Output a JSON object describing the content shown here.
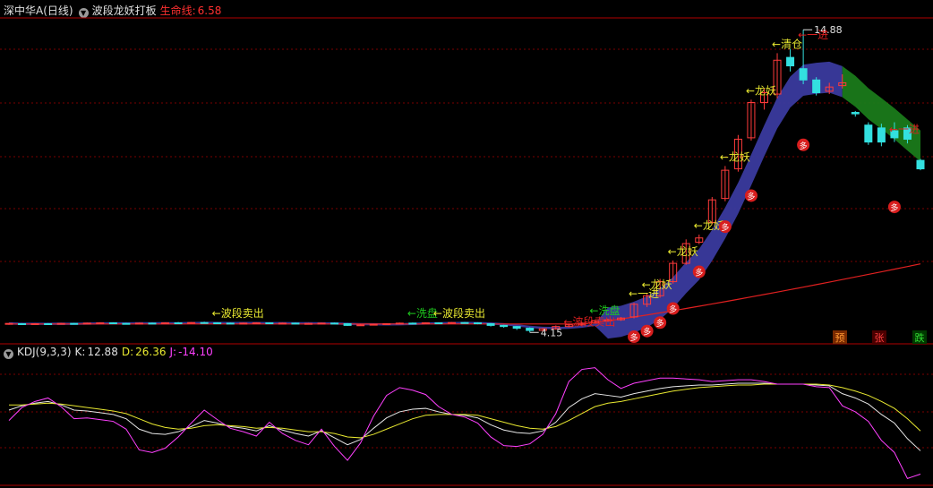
{
  "header": {
    "stock_title": "深中华A(日线)",
    "indicator_name": "波段龙妖打板",
    "lifeline_label": "生命线:",
    "lifeline_value": "6.58"
  },
  "kdj": {
    "title": "KDJ(9,3,3)",
    "k_label": "K:",
    "k_value": "12.88",
    "d_label": "D:",
    "d_value": "26.36",
    "j_label": "J:",
    "j_value": "-14.10"
  },
  "chart_data": [
    {
      "type": "candlestick",
      "title": "深中华A(日线)",
      "price_high_label": "14.88",
      "price_low_label": "4.15",
      "x": [
        1,
        2,
        3,
        4,
        5,
        6,
        7,
        8,
        9,
        10,
        11,
        12,
        13,
        14,
        15,
        16,
        17,
        18,
        19,
        20,
        21,
        22,
        23,
        24,
        25,
        26,
        27,
        28,
        29,
        30,
        31,
        32,
        33,
        34,
        35,
        36,
        37,
        38,
        39,
        40,
        41,
        42,
        43,
        44,
        45,
        46,
        47,
        48,
        49,
        50,
        51,
        52,
        53,
        54,
        55,
        56,
        57,
        58,
        59,
        60,
        61,
        62,
        63,
        64,
        65,
        66,
        67,
        68,
        69,
        70,
        71
      ],
      "candles": [
        [
          4.45,
          4.47,
          4.49,
          4.42
        ],
        [
          4.46,
          4.44,
          4.48,
          4.42
        ],
        [
          4.44,
          4.46,
          4.48,
          4.42
        ],
        [
          4.46,
          4.45,
          4.48,
          4.43
        ],
        [
          4.45,
          4.47,
          4.49,
          4.43
        ],
        [
          4.47,
          4.46,
          4.49,
          4.44
        ],
        [
          4.46,
          4.48,
          4.5,
          4.44
        ],
        [
          4.48,
          4.49,
          4.51,
          4.46
        ],
        [
          4.49,
          4.47,
          4.51,
          4.45
        ],
        [
          4.47,
          4.46,
          4.49,
          4.44
        ],
        [
          4.46,
          4.48,
          4.5,
          4.44
        ],
        [
          4.48,
          4.47,
          4.5,
          4.45
        ],
        [
          4.47,
          4.49,
          4.51,
          4.45
        ],
        [
          4.49,
          4.48,
          4.52,
          4.46
        ],
        [
          4.48,
          4.5,
          4.52,
          4.46
        ],
        [
          4.5,
          4.49,
          4.53,
          4.47
        ],
        [
          4.49,
          4.48,
          4.51,
          4.46
        ],
        [
          4.48,
          4.47,
          4.5,
          4.45
        ],
        [
          4.47,
          4.48,
          4.5,
          4.45
        ],
        [
          4.48,
          4.49,
          4.51,
          4.46
        ],
        [
          4.49,
          4.47,
          4.51,
          4.45
        ],
        [
          4.47,
          4.48,
          4.5,
          4.45
        ],
        [
          4.48,
          4.46,
          4.5,
          4.44
        ],
        [
          4.46,
          4.47,
          4.49,
          4.44
        ],
        [
          4.47,
          4.48,
          4.5,
          4.45
        ],
        [
          4.48,
          4.46,
          4.5,
          4.44
        ],
        [
          4.46,
          4.4,
          4.48,
          4.38
        ],
        [
          4.4,
          4.42,
          4.45,
          4.38
        ],
        [
          4.42,
          4.44,
          4.46,
          4.4
        ],
        [
          4.44,
          4.46,
          4.48,
          4.42
        ],
        [
          4.46,
          4.48,
          4.5,
          4.44
        ],
        [
          4.48,
          4.47,
          4.5,
          4.45
        ],
        [
          4.47,
          4.49,
          4.51,
          4.45
        ],
        [
          4.49,
          4.48,
          4.51,
          4.46
        ],
        [
          4.48,
          4.5,
          4.52,
          4.46
        ],
        [
          4.5,
          4.49,
          4.52,
          4.47
        ],
        [
          4.49,
          4.46,
          4.51,
          4.44
        ],
        [
          4.46,
          4.4,
          4.48,
          4.36
        ],
        [
          4.4,
          4.36,
          4.42,
          4.32
        ],
        [
          4.36,
          4.3,
          4.38,
          4.24
        ],
        [
          4.3,
          4.22,
          4.33,
          4.15
        ],
        [
          4.22,
          4.28,
          4.31,
          4.18
        ],
        [
          4.28,
          4.36,
          4.4,
          4.25
        ],
        [
          4.36,
          4.42,
          4.46,
          4.33
        ],
        [
          4.42,
          4.48,
          4.52,
          4.39
        ],
        [
          4.48,
          4.56,
          4.6,
          4.46
        ],
        [
          4.56,
          4.6,
          4.64,
          4.52
        ],
        [
          4.6,
          4.66,
          4.7,
          4.56
        ],
        [
          4.7,
          5.15,
          5.2,
          4.65
        ],
        [
          5.15,
          5.45,
          5.52,
          5.05
        ],
        [
          5.45,
          5.95,
          6.05,
          5.38
        ],
        [
          5.95,
          6.6,
          6.7,
          5.88
        ],
        [
          6.6,
          7.3,
          7.45,
          6.55
        ],
        [
          7.35,
          7.5,
          7.62,
          7.28
        ],
        [
          8.05,
          8.85,
          8.95,
          7.98
        ],
        [
          8.9,
          9.9,
          10.05,
          8.8
        ],
        [
          9.95,
          11.0,
          11.15,
          9.85
        ],
        [
          11.05,
          12.3,
          12.4,
          10.95
        ],
        [
          12.3,
          12.65,
          12.8,
          12.05
        ],
        [
          12.6,
          13.8,
          14.05,
          12.45
        ],
        [
          13.9,
          13.6,
          14.2,
          13.4
        ],
        [
          13.5,
          13.1,
          14.88,
          12.95
        ],
        [
          13.1,
          12.65,
          13.2,
          12.55
        ],
        [
          12.7,
          12.85,
          13.0,
          12.6
        ],
        [
          12.9,
          13.0,
          13.3,
          12.8
        ],
        [
          11.95,
          11.9,
          12.0,
          11.8
        ],
        [
          11.5,
          10.9,
          11.6,
          10.8
        ],
        [
          11.4,
          10.9,
          11.55,
          10.75
        ],
        [
          11.3,
          11.05,
          11.6,
          10.9
        ],
        [
          11.4,
          11.0,
          11.5,
          10.85
        ],
        [
          10.25,
          9.95,
          10.3,
          9.9
        ]
      ],
      "lifeline_last": 6.58,
      "signals": [
        "波段卖出",
        "洗盘",
        "波段卖出",
        "洗盘",
        "波段卖出",
        "一进",
        "龙妖",
        "龙妖",
        "龙妖",
        "龙妖",
        "龙妖",
        "清仓",
        "一进",
        "一进",
        "多"
      ],
      "ylim": [
        4.0,
        15.3
      ]
    },
    {
      "type": "line",
      "title": "KDJ(9,3,3)",
      "x": [
        1,
        2,
        3,
        4,
        5,
        6,
        7,
        8,
        9,
        10,
        11,
        12,
        13,
        14,
        15,
        16,
        17,
        18,
        19,
        20,
        21,
        22,
        23,
        24,
        25,
        26,
        27,
        28,
        29,
        30,
        31,
        32,
        33,
        34,
        35,
        36,
        37,
        38,
        39,
        40,
        41,
        42,
        43,
        44,
        45,
        46,
        47,
        48,
        49,
        50,
        51,
        52,
        53,
        54,
        55,
        56,
        57,
        58,
        59,
        60,
        61,
        62,
        63,
        64,
        65,
        66,
        67,
        68,
        69,
        70,
        71
      ],
      "series": [
        {
          "name": "K",
          "values": [
            60,
            65,
            68,
            70,
            66,
            60,
            59,
            57,
            55,
            50,
            38,
            33,
            32,
            35,
            41,
            48,
            45,
            41,
            39,
            36,
            42,
            37,
            33,
            30,
            36,
            28,
            20,
            26,
            39,
            51,
            58,
            61,
            62,
            58,
            55,
            54,
            51,
            43,
            37,
            34,
            33,
            36,
            46,
            63,
            73,
            79,
            77,
            75,
            79,
            82,
            85,
            87,
            88,
            89,
            89,
            90,
            91,
            91,
            91,
            90,
            90,
            90,
            89,
            88,
            79,
            74,
            67,
            55,
            45,
            27,
            13
          ]
        },
        {
          "name": "D",
          "values": [
            66,
            66,
            67,
            68,
            67,
            65,
            63,
            61,
            59,
            56,
            50,
            44,
            40,
            38,
            39,
            42,
            43,
            42,
            41,
            39,
            40,
            39,
            37,
            35,
            35,
            33,
            29,
            28,
            32,
            38,
            44,
            50,
            54,
            55,
            55,
            55,
            54,
            50,
            46,
            42,
            39,
            38,
            41,
            48,
            56,
            64,
            68,
            70,
            73,
            76,
            79,
            82,
            84,
            86,
            87,
            88,
            89,
            89,
            90,
            90,
            90,
            90,
            90,
            89,
            86,
            82,
            77,
            70,
            62,
            50,
            36
          ]
        },
        {
          "name": "J",
          "values": [
            48,
            63,
            70,
            74,
            64,
            50,
            51,
            49,
            47,
            38,
            14,
            11,
            16,
            29,
            45,
            60,
            49,
            39,
            35,
            30,
            46,
            33,
            25,
            20,
            38,
            18,
            2,
            22,
            53,
            77,
            86,
            83,
            78,
            64,
            55,
            52,
            45,
            29,
            19,
            18,
            21,
            32,
            56,
            93,
            107,
            109,
            95,
            85,
            91,
            94,
            97,
            97,
            96,
            95,
            93,
            94,
            95,
            95,
            93,
            90,
            90,
            90,
            87,
            86,
            65,
            58,
            47,
            25,
            11,
            -19,
            -14
          ]
        }
      ],
      "ylim": [
        -30,
        120
      ]
    }
  ],
  "bottom_tags": [
    "预",
    "张",
    "跌"
  ]
}
